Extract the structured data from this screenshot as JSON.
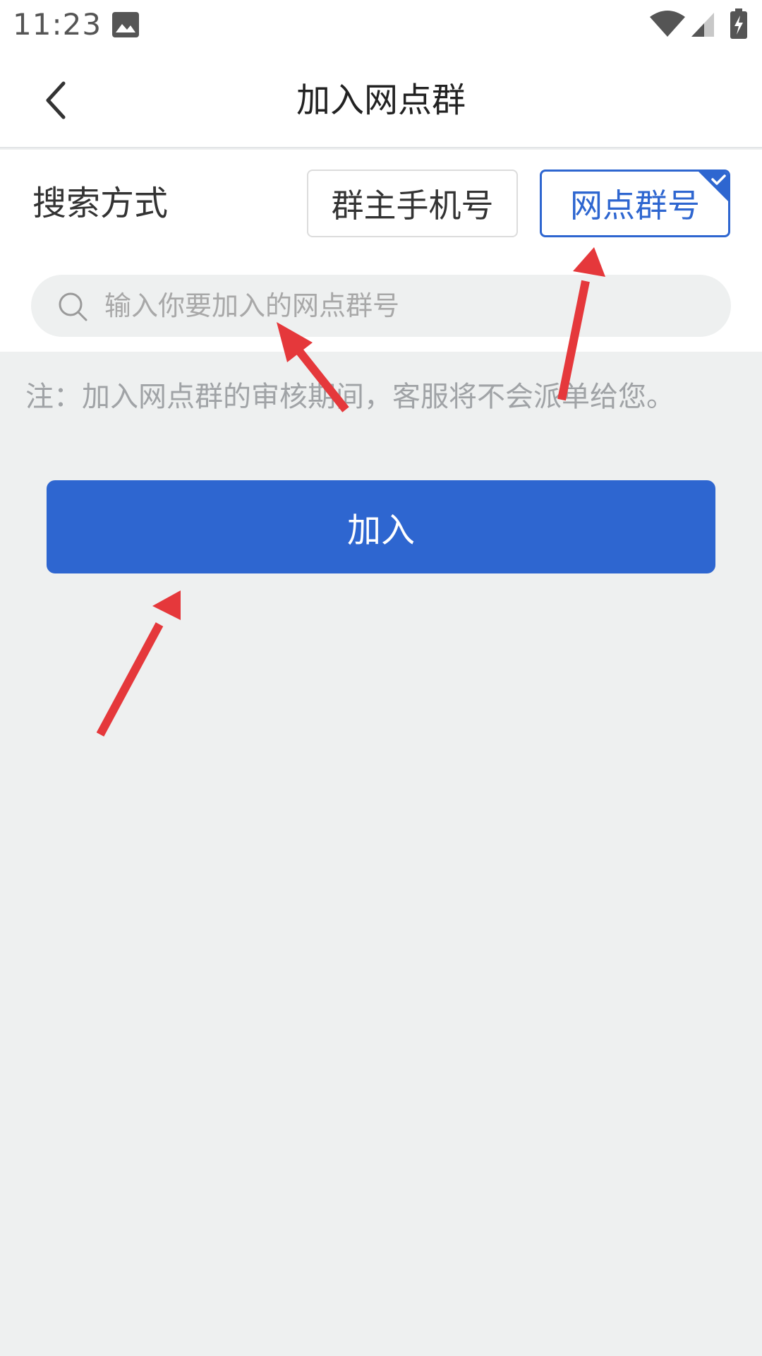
{
  "status_bar": {
    "time": "11:23",
    "icons": [
      "gallery-icon",
      "wifi-icon",
      "signal-icon",
      "battery-charging-icon"
    ]
  },
  "header": {
    "title": "加入网点群",
    "back_icon": "chevron-left-icon"
  },
  "search_method": {
    "label": "搜索方式",
    "options": [
      {
        "label": "群主手机号",
        "selected": false
      },
      {
        "label": "网点群号",
        "selected": true
      }
    ]
  },
  "search": {
    "placeholder": "输入你要加入的网点群号",
    "value": "",
    "icon": "search-icon"
  },
  "note": "注：加入网点群的审核期间，客服将不会派单给您。",
  "join_button": {
    "label": "加入"
  },
  "colors": {
    "primary": "#2e66d0",
    "background": "#eef0f0",
    "annotation_arrow": "#e5383b"
  }
}
